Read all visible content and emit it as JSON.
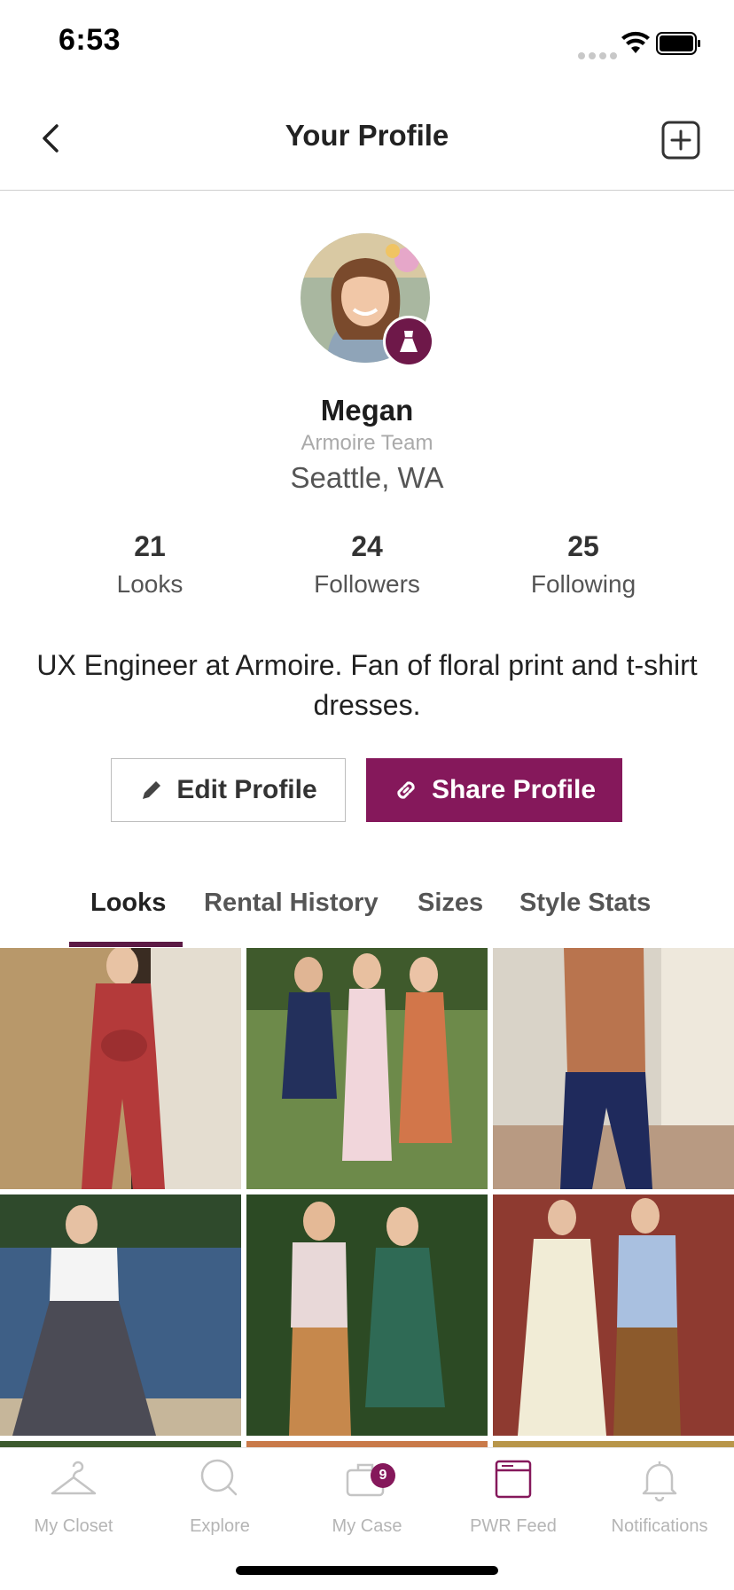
{
  "status_bar": {
    "time": "6:53"
  },
  "header": {
    "title": "Your Profile"
  },
  "profile": {
    "name": "Megan",
    "team": "Armoire Team",
    "location": "Seattle, WA",
    "stats": [
      {
        "value": "21",
        "label": "Looks"
      },
      {
        "value": "24",
        "label": "Followers"
      },
      {
        "value": "25",
        "label": "Following"
      }
    ],
    "bio": "UX Engineer at Armoire. Fan of floral print and t-shirt dresses."
  },
  "actions": {
    "edit_label": "Edit Profile",
    "share_label": "Share Profile"
  },
  "tabs": [
    {
      "label": "Looks",
      "active": true
    },
    {
      "label": "Rental History"
    },
    {
      "label": "Sizes"
    },
    {
      "label": "Style Stats"
    }
  ],
  "nav": [
    {
      "label": "My Closet",
      "icon": "hanger-icon"
    },
    {
      "label": "Explore",
      "icon": "search-icon"
    },
    {
      "label": "My Case",
      "icon": "case-icon",
      "badge": "9"
    },
    {
      "label": "PWR Feed",
      "icon": "feed-icon",
      "active": true
    },
    {
      "label": "Notifications",
      "icon": "bell-icon"
    }
  ],
  "colors": {
    "brand": "#85185b",
    "brand_dark": "#6e1849"
  }
}
